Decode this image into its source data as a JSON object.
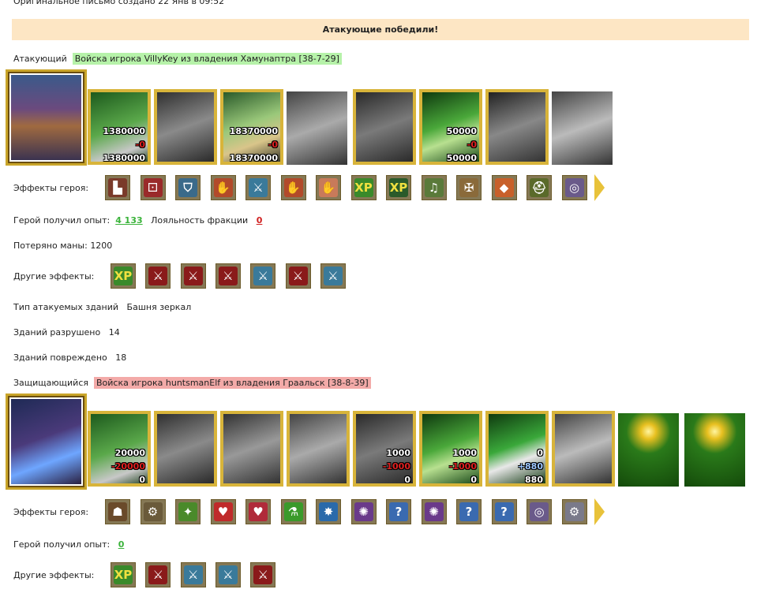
{
  "header": {
    "original_letter": "Оригинальное письмо создано 22 Янв в 09:52"
  },
  "result": {
    "text": "Атакующие победили!"
  },
  "attacker": {
    "label": "Атакующий",
    "army": "Войска игрока VillyKey из владения Хамунаптра [38-7-29]",
    "units": [
      {
        "name": "dwarf-unit",
        "top": "1380000",
        "mid": "-0",
        "bottom": "1380000"
      },
      {
        "name": "dark-knight-unit",
        "top": "",
        "mid": "",
        "bottom": ""
      },
      {
        "name": "paladin-unit",
        "top": "18370000",
        "mid": "-0",
        "bottom": "18370000"
      },
      {
        "name": "griffin-unit",
        "top": "",
        "mid": "",
        "bottom": ""
      },
      {
        "name": "archer-unit",
        "top": "",
        "mid": "",
        "bottom": ""
      },
      {
        "name": "elf-druid-unit",
        "top": "50000",
        "mid": "-0",
        "bottom": "50000"
      },
      {
        "name": "hooded-knight-unit",
        "top": "",
        "mid": "",
        "bottom": ""
      },
      {
        "name": "statue-unit",
        "top": "",
        "mid": "",
        "bottom": ""
      }
    ],
    "effects_label": "Эффекты героя:",
    "effect_icons": [
      "castle-icon",
      "dice-icon",
      "shield-icon",
      "handshake-icon",
      "sword-icon",
      "handshake-icon",
      "hand-icon",
      "xp-icon",
      "xp-tree-icon",
      "bell-icon",
      "cross-icon",
      "gem-icon",
      "helmet-icon",
      "ring-icon"
    ],
    "experience_label": "Герой получил опыт:",
    "experience_value": "4 133",
    "loyalty_label": "Лояльность фракции",
    "loyalty_value": "0",
    "mana_lost": "Потеряно маны: 1200",
    "other_effects_label": "Другие эффекты:",
    "other_effect_icons": [
      "xp-icon",
      "fist-sword-icon",
      "fist-sword-icon",
      "fist-sword-icon",
      "sword-icon",
      "fist-sword-icon",
      "sword-icon"
    ],
    "building_type_label": "Тип атакуемых зданий",
    "building_type_value": "Башня зеркал",
    "destroyed_label": "Зданий разрушено",
    "destroyed_value": "14",
    "damaged_label": "Зданий повреждено",
    "damaged_value": "18"
  },
  "defender": {
    "label": "Защищающийся",
    "army": "Войска игрока huntsmanElf из владения Граальск [38-8-39]",
    "units": [
      {
        "name": "dwarf-unit",
        "top": "20000",
        "mid": "-20000",
        "bottom": "0"
      },
      {
        "name": "dark-knight-unit",
        "top": "",
        "mid": "",
        "bottom": ""
      },
      {
        "name": "knight-unit",
        "top": "",
        "mid": "",
        "bottom": ""
      },
      {
        "name": "griffin-unit",
        "top": "",
        "mid": "",
        "bottom": ""
      },
      {
        "name": "archer-unit",
        "top": "1000",
        "mid": "-1000",
        "bottom": "0"
      },
      {
        "name": "elf-druid-unit",
        "top": "1000",
        "mid": "-1000",
        "bottom": "0"
      },
      {
        "name": "green-knight-unit",
        "top": "0",
        "mid": "+880",
        "bottom": "880"
      },
      {
        "name": "statue-unit",
        "top": "",
        "mid": "",
        "bottom": ""
      },
      {
        "name": "mirror-tower-unit",
        "top": "",
        "mid": "",
        "bottom": ""
      },
      {
        "name": "mirror-tower-unit",
        "top": "",
        "mid": "",
        "bottom": ""
      }
    ],
    "effects_label": "Эффекты героя:",
    "effect_icons": [
      "mask-icon",
      "mask-gears-icon",
      "wand-icon",
      "heart-icon",
      "heart-hand-icon",
      "potion-icon",
      "spark-icon",
      "rune-icon",
      "question-icon",
      "rune-icon",
      "question-icon",
      "question-icon",
      "ring-icon",
      "gears-icon"
    ],
    "experience_label": "Герой получил опыт:",
    "experience_value": "0",
    "other_effects_label": "Другие эффекты:",
    "other_effect_icons": [
      "xp-icon",
      "fist-sword-icon",
      "sword-icon",
      "sword-icon",
      "fist-sword-icon"
    ]
  },
  "colors": {
    "banner": "#fde6c4",
    "attacker_army": "#b6f2a9",
    "defender_army": "#f3aaa8",
    "gold_frame": "#d8b43a"
  }
}
